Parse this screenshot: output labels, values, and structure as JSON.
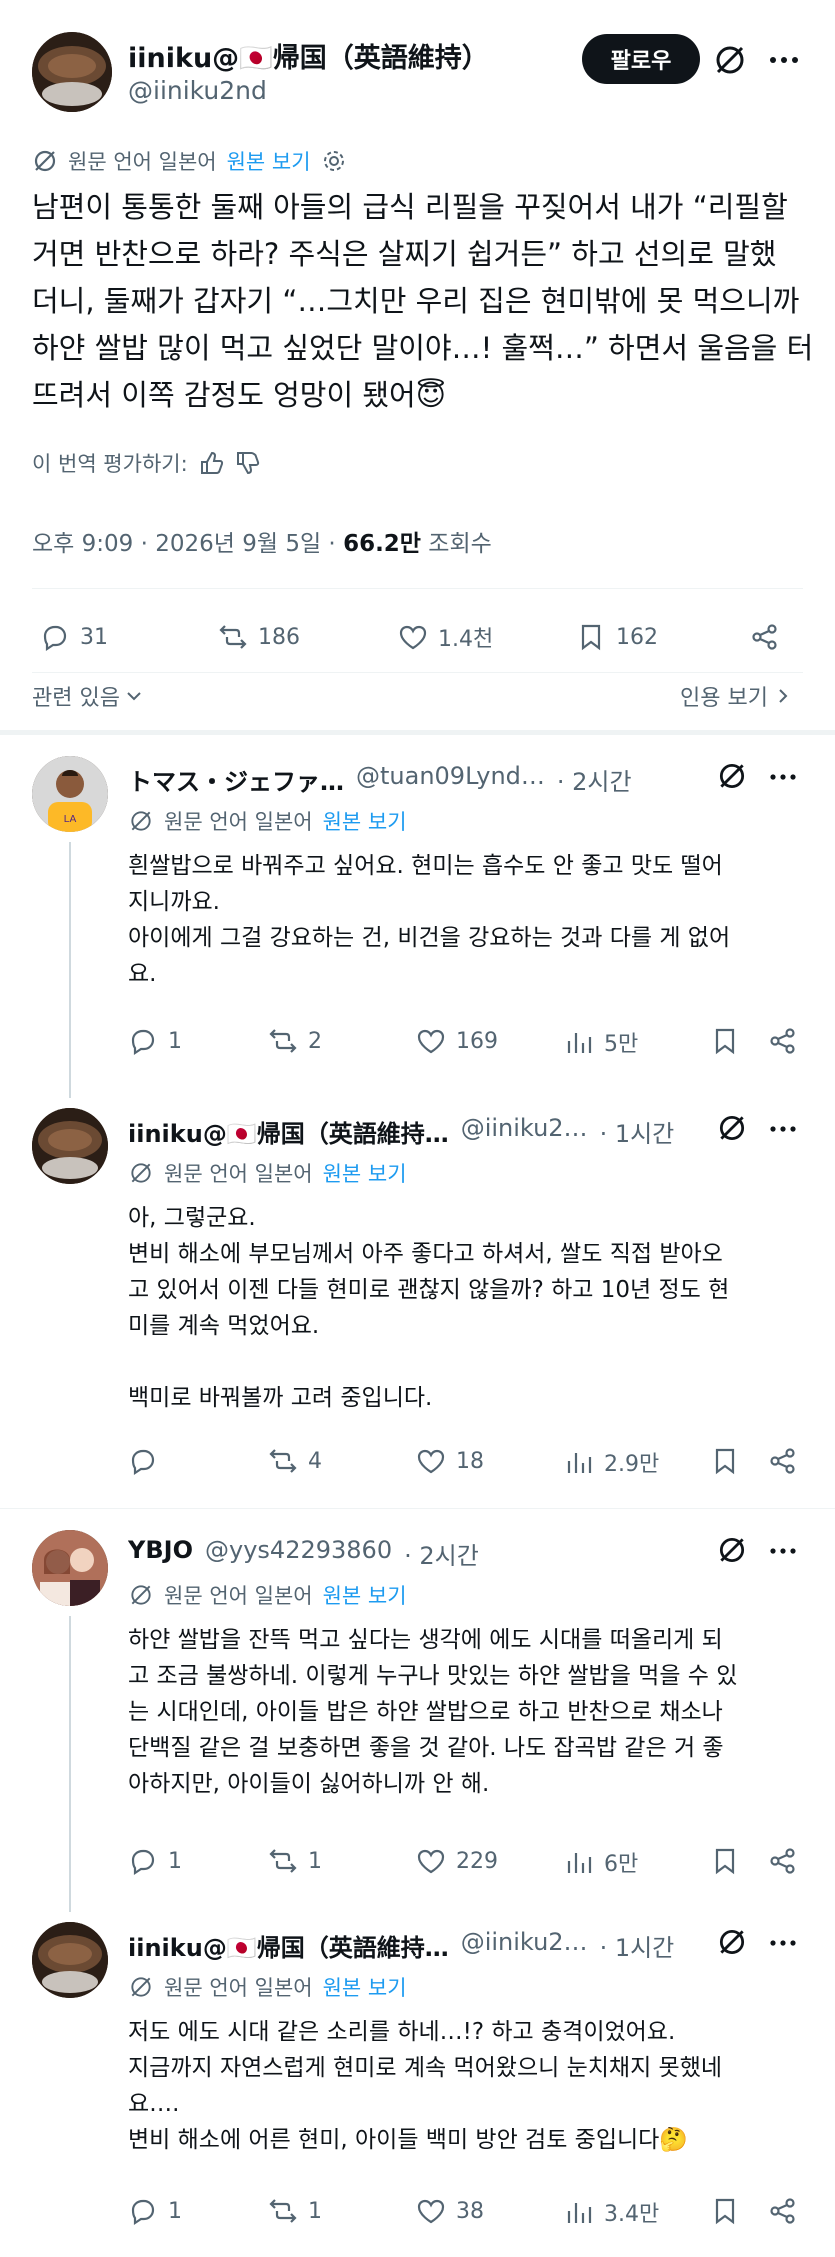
{
  "main_post": {
    "author_name": "iiniku@🇯🇵帰国（英語維持）",
    "author_handle": "@iiniku2nd",
    "follow_label": "팔로우",
    "translation": {
      "language": "원문 언어 일본어",
      "view_original": "원본 보기"
    },
    "text": "남편이 통통한 둘째 아들의 급식 리필을 꾸짖어서 내가 “리필할\n거면 반찬으로 하라? 주식은 살찌기 쉽거든” 하고 선의로 말했\n더니, 둘째가 갑자기 “…그치만 우리 집은 현미밖에 못 먹으니까\n하얀 쌀밥 많이 먹고 싶었단 말이야…! 훌쩍…” 하면서 울음을 터\n뜨려서 이쪽 감정도 엉망이 됐어😇",
    "rate_translation": "이 번역 평가하기:",
    "time": "오후 9:09 · 2026년 9월 5일 · ",
    "views_count": "66.2만",
    "views_label": " 조회수",
    "stats": {
      "replies": "31",
      "reposts": "186",
      "likes": "1.4천",
      "bookmarks": "162"
    },
    "related_label": "관련 있음",
    "quotes_label": "인용 보기"
  },
  "replies": [
    {
      "author_name": "トマス・ジェファ…",
      "author_handle": "@tuan09Lynd…",
      "time": "· 2시간",
      "translation_language": "원문 언어 일본어",
      "view_original": "원본 보기",
      "text": "흰쌀밥으로 바꿔주고 싶어요. 현미는 흡수도 안 좋고 맛도 떨어\n지니까요.\n아이에게 그걸 강요하는 건, 비건을 강요하는 것과 다를 게 없어\n요.",
      "stats": {
        "replies": "1",
        "reposts": "2",
        "likes": "169",
        "views": "5만"
      }
    },
    {
      "author_name": "iiniku@🇯🇵帰国（英語維持…",
      "author_handle": "@iiniku2…",
      "time": "· 1시간",
      "translation_language": "원문 언어 일본어",
      "view_original": "원본 보기",
      "text": "아, 그렇군요.\n변비 해소에 부모님께서 아주 좋다고 하셔서, 쌀도 직접 받아오\n고 있어서 이젠 다들 현미로 괜찮지 않을까? 하고 10년 정도 현\n미를 계속 먹었어요.\n\n백미로 바꿔볼까 고려 중입니다.",
      "stats": {
        "replies": "",
        "reposts": "4",
        "likes": "18",
        "views": "2.9만"
      }
    },
    {
      "author_name": "YBJO",
      "author_handle": "@yys42293860",
      "time": "· 2시간",
      "translation_language": "원문 언어 일본어",
      "view_original": "원본 보기",
      "text": "하얀 쌀밥을 잔뜩 먹고 싶다는 생각에 에도 시대를 떠올리게 되\n고 조금 불쌍하네. 이렇게 누구나 맛있는 하얀 쌀밥을 먹을 수 있\n는 시대인데, 아이들 밥은 하얀 쌀밥으로 하고 반찬으로 채소나\n단백질 같은 걸 보충하면 좋을 것 같아. 나도 잡곡밥 같은 거 좋\n아하지만, 아이들이 싫어하니까 안 해.",
      "stats": {
        "replies": "1",
        "reposts": "1",
        "likes": "229",
        "views": "6만"
      }
    },
    {
      "author_name": "iiniku@🇯🇵帰国（英語維持…",
      "author_handle": "@iiniku2…",
      "time": "· 1시간",
      "translation_language": "원문 언어 일본어",
      "view_original": "원본 보기",
      "text": "저도 에도 시대 같은 소리를 하네…!? 하고 충격이었어요.\n지금까지 자연스럽게 현미로 계속 먹어왔으니 눈치채지 못했네\n요….\n변비 해소에 어른 현미, 아이들 백미 방안 검토 중입니다🤔",
      "stats": {
        "replies": "1",
        "reposts": "1",
        "likes": "38",
        "views": "3.4만"
      }
    }
  ],
  "colors": {
    "text": "#0f1419",
    "secondary": "#536471",
    "accent": "#1d9bf0",
    "divider": "#eff3f4"
  },
  "icons": [
    "grok-icon",
    "more-icon",
    "translate-icon",
    "gear-icon",
    "thumbs-up-icon",
    "thumbs-down-icon",
    "reply-icon",
    "repost-icon",
    "like-icon",
    "bookmark-icon",
    "share-icon",
    "views-icon",
    "chevron-down-icon",
    "chevron-right-icon"
  ]
}
